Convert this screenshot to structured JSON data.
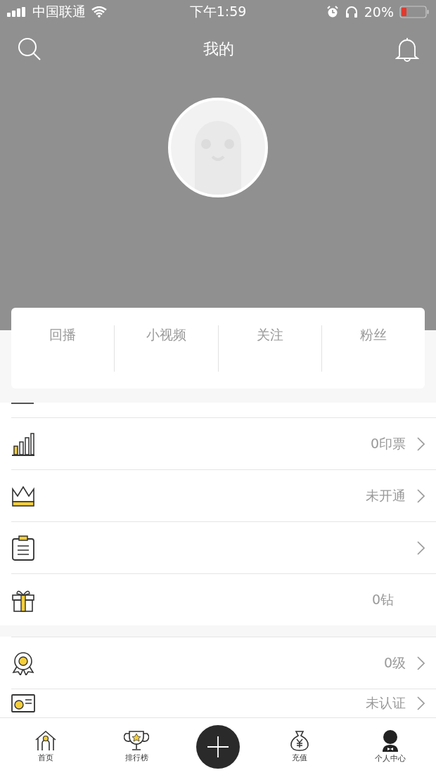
{
  "status_bar": {
    "carrier": "中国联通",
    "time": "下午1:59",
    "battery": "20%"
  },
  "header": {
    "title": "我的"
  },
  "stats": [
    {
      "label": "回播"
    },
    {
      "label": "小视频"
    },
    {
      "label": "关注"
    },
    {
      "label": "粉丝"
    }
  ],
  "menu": [
    {
      "kind": "chart",
      "value": "0印票",
      "arrow": true
    },
    {
      "kind": "crown",
      "value": "未开通",
      "arrow": true
    },
    {
      "kind": "clipboard",
      "arrow": true
    },
    {
      "kind": "gift",
      "value": "0钻",
      "arrow": false
    },
    {
      "kind": "medal",
      "value": "0级",
      "arrow": true,
      "gap_before": true
    },
    {
      "kind": "card",
      "value": "未认证",
      "arrow": true
    }
  ],
  "tab_bar": [
    {
      "kind": "home",
      "label": "首页"
    },
    {
      "kind": "trophy",
      "label": "排行榜"
    },
    {
      "kind": "plus"
    },
    {
      "kind": "money",
      "label": "充值"
    },
    {
      "kind": "person",
      "label": "个人中心"
    }
  ]
}
